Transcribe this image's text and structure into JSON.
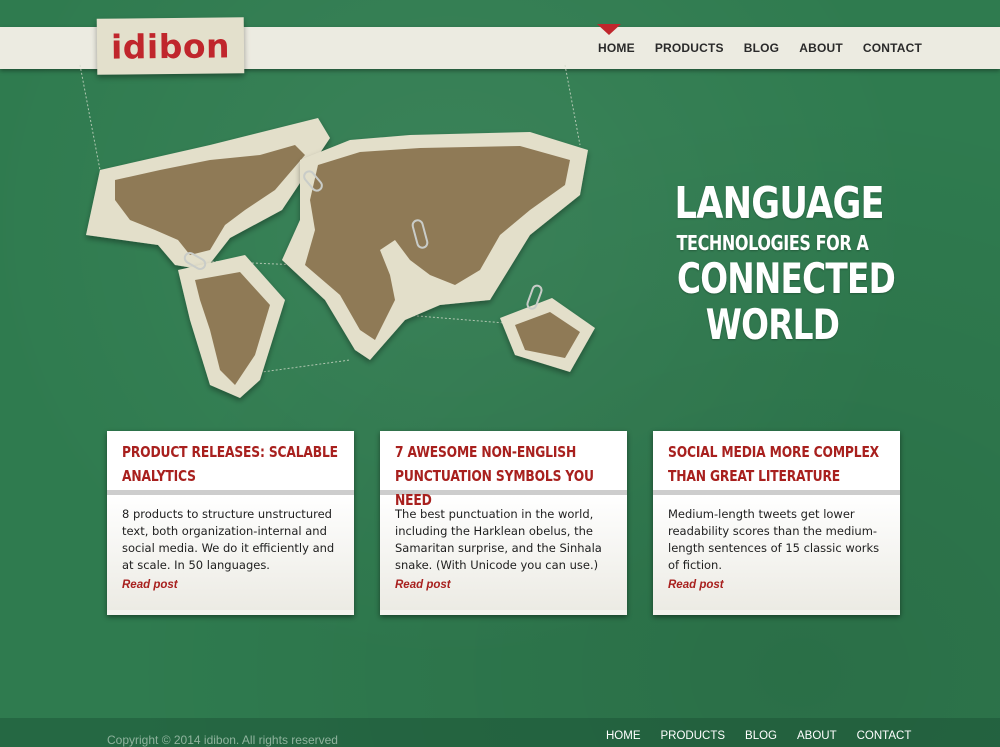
{
  "brand": {
    "logo": "idibon",
    "logo_color": "#c0262c"
  },
  "nav": {
    "items": [
      "HOME",
      "PRODUCTS",
      "BLOG",
      "ABOUT",
      "CONTACT"
    ],
    "active": "HOME"
  },
  "hero": {
    "line1": "LANGUAGE",
    "line2": "TECHNOLOGIES FOR A",
    "line3": "CONNECTED",
    "line4": "WORLD",
    "image": "world-map-paper-cutouts"
  },
  "cards": [
    {
      "title": "PRODUCT RELEASES: SCALABLE ANALYTICS",
      "text": "8 products to structure unstructured text, both organization-internal and social media. We do it efficiently and at scale. In 50 languages.",
      "link": "Read post"
    },
    {
      "title": "7 AWESOME NON-ENGLISH PUNCTUATION SYMBOLS YOU NEED",
      "text": "The best punctuation in the world, including the Harklean obelus, the Samaritan surprise, and the Sinhala snake. (With Unicode you can use.)",
      "link": "Read post"
    },
    {
      "title": "SOCIAL MEDIA MORE COMPLEX THAN GREAT LITERATURE",
      "text": "Medium-length tweets get lower readability scores than the medium-length sentences of 15 classic works of fiction.",
      "link": "Read post"
    }
  ],
  "footer": {
    "copyright": "Copyright © 2014 idibon. All rights reserved",
    "nav": [
      "HOME",
      "PRODUCTS",
      "BLOG",
      "ABOUT",
      "CONTACT"
    ]
  },
  "colors": {
    "background": "#2f7b4f",
    "accent": "#a8201e",
    "paper": "#e3dfca",
    "land": "#8f7a57"
  }
}
